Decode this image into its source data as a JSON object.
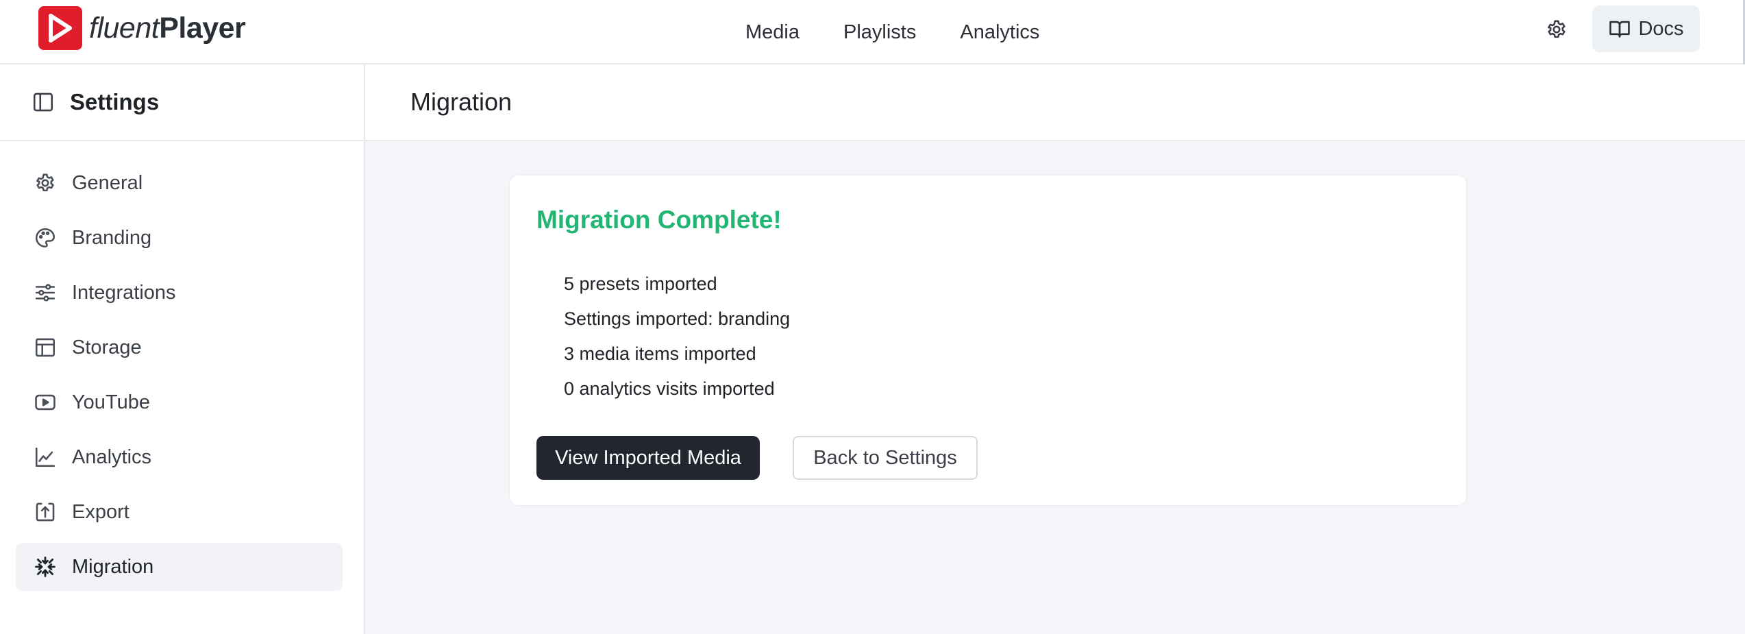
{
  "brand": {
    "name_light": "fluent",
    "name_bold": "Player",
    "logo_color": "#e01e2b"
  },
  "topnav": {
    "items": [
      {
        "label": "Media"
      },
      {
        "label": "Playlists"
      },
      {
        "label": "Analytics"
      }
    ]
  },
  "header_actions": {
    "settings_icon": "gear-icon",
    "docs_label": "Docs",
    "docs_icon": "book-open-icon"
  },
  "sidebar": {
    "title": "Settings",
    "toggle_icon": "sidebar-panel-icon",
    "items": [
      {
        "label": "General",
        "icon": "gear-icon",
        "active": false
      },
      {
        "label": "Branding",
        "icon": "palette-icon",
        "active": false
      },
      {
        "label": "Integrations",
        "icon": "sliders-icon",
        "active": false
      },
      {
        "label": "Storage",
        "icon": "layout-icon",
        "active": false
      },
      {
        "label": "YouTube",
        "icon": "youtube-icon",
        "active": false
      },
      {
        "label": "Analytics",
        "icon": "chart-line-icon",
        "active": false
      },
      {
        "label": "Export",
        "icon": "export-icon",
        "active": false
      },
      {
        "label": "Migration",
        "icon": "arrows-in-icon",
        "active": true
      }
    ]
  },
  "main": {
    "title": "Migration",
    "card": {
      "title": "Migration Complete!",
      "results": [
        "5 presets imported",
        "Settings imported: branding",
        "3 media items imported",
        "0 analytics visits imported"
      ],
      "primary_button": "View Imported Media",
      "secondary_button": "Back to Settings"
    }
  },
  "colors": {
    "success": "#22b573",
    "primary_button": "#22262e",
    "page_bg": "#f4f5f9"
  }
}
